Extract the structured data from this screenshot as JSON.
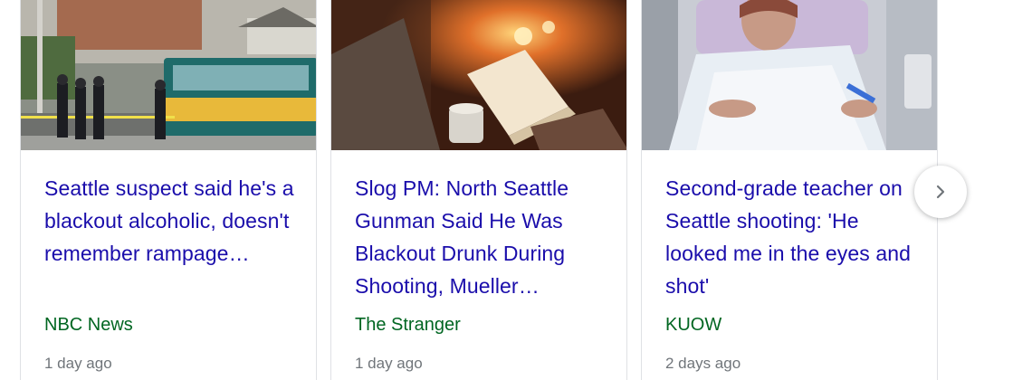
{
  "cards": [
    {
      "headline": "Seattle suspect said he's a blackout alcoholic, doesn't remember rampage…",
      "source": "NBC News",
      "age": "1 day ago",
      "image": "police-and-bus-scene"
    },
    {
      "headline": "Slog PM: North Seattle Gunman Said He Was Blackout Drunk During Shooting, Mueller…",
      "source": "The Stranger",
      "age": "1 day ago",
      "image": "person-reading-by-fireplace"
    },
    {
      "headline": "Second-grade teacher on Seattle shooting: 'He looked me in the eyes and shot'",
      "source": "KUOW",
      "age": "2 days ago",
      "image": "woman-in-hospital-bed"
    }
  ],
  "next_button": {
    "icon": "chevron-right-icon"
  },
  "colors": {
    "headline": "#1a0dab",
    "source": "#006621",
    "age": "#70757a",
    "border": "#dfe1e5"
  }
}
